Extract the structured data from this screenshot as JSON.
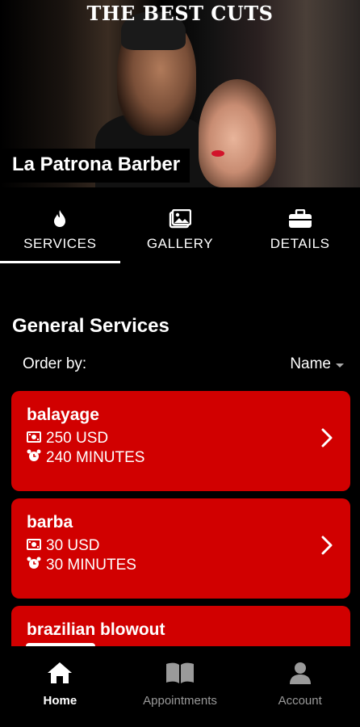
{
  "hero": {
    "tagline": "THE BEST CUTS",
    "shop_name": "La Patrona Barber"
  },
  "tabs": [
    {
      "label": "SERVICES",
      "icon": "flame-icon",
      "active": true
    },
    {
      "label": "GALLERY",
      "icon": "image-icon",
      "active": false
    },
    {
      "label": "DETAILS",
      "icon": "briefcase-icon",
      "active": false
    }
  ],
  "section": {
    "title": "General Services",
    "order_label": "Order by:",
    "order_value": "Name"
  },
  "services": [
    {
      "name": "balayage",
      "price": "250 USD",
      "duration": "240 MINUTES"
    },
    {
      "name": "barba",
      "price": "30 USD",
      "duration": "30 MINUTES"
    },
    {
      "name": "brazilian blowout",
      "price": "",
      "duration": ""
    }
  ],
  "bottom_nav": [
    {
      "label": "Home",
      "icon": "home-icon",
      "active": true
    },
    {
      "label": "Appointments",
      "icon": "book-icon",
      "active": false
    },
    {
      "label": "Account",
      "icon": "user-icon",
      "active": false
    }
  ],
  "colors": {
    "background": "#000000",
    "card": "#d10000",
    "text": "#ffffff",
    "muted": "#9a9a9a"
  }
}
